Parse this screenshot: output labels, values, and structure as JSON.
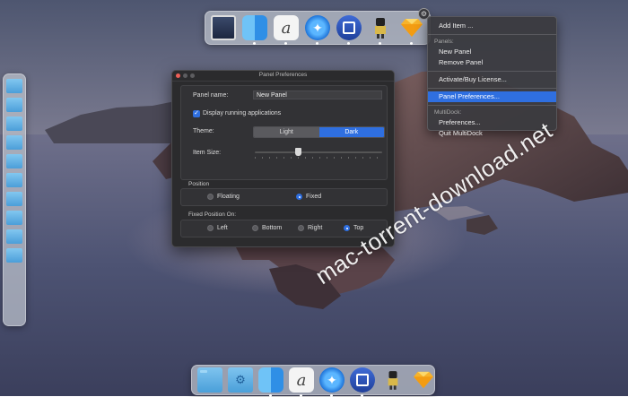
{
  "top_dock": {
    "items": [
      {
        "name": "monitor-app"
      },
      {
        "name": "finder"
      },
      {
        "name": "script-editor"
      },
      {
        "name": "safari"
      },
      {
        "name": "window-app"
      },
      {
        "name": "robot-app"
      },
      {
        "name": "sketch"
      }
    ]
  },
  "menu": {
    "add_item": "Add Item ...",
    "panels_header": "Panels:",
    "new_panel": "New Panel",
    "remove_panel": "Remove Panel",
    "activate": "Activate/Buy License...",
    "panel_preferences": "Panel Preferences...",
    "multidock_header": "MultiDock:",
    "preferences": "Preferences...",
    "quit": "Quit MultiDock"
  },
  "window": {
    "title": "Panel Preferences",
    "panel_name_label": "Panel name:",
    "panel_name_value": "New Panel",
    "display_running_label": "Display running applications",
    "display_running_checked": true,
    "theme_label": "Theme:",
    "theme_options": [
      "Light",
      "Dark"
    ],
    "theme_selected": "Dark",
    "item_size_label": "Item Size:",
    "item_size_fraction": 0.33,
    "position_title": "Position",
    "position_options": [
      "Floating",
      "Fixed"
    ],
    "position_selected": "Fixed",
    "fixed_title": "Fixed Position On:",
    "fixed_options": [
      "Left",
      "Bottom",
      "Right",
      "Top"
    ],
    "fixed_selected": "Top"
  },
  "watermark": "mac-torrent-download.net",
  "colors": {
    "accent": "#2f6fe0",
    "menu_bg": "#3a3a3e",
    "window_bg": "#2b2b2d"
  }
}
